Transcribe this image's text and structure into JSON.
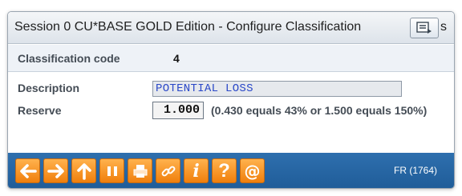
{
  "window": {
    "title": "Session 0 CU*BASE GOLD Edition - Configure Classification",
    "title_overflow": "s"
  },
  "header": {
    "classification_label": "Classification code",
    "classification_value": "4"
  },
  "form": {
    "description_label": "Description",
    "description_value": "POTENTIAL LOSS",
    "reserve_label": "Reserve",
    "reserve_value": "1.000",
    "reserve_hint": "(0.430 equals 43% or 1.500 equals 150%)"
  },
  "toolbar": {
    "buttons": [
      {
        "icon": "back-arrow-icon"
      },
      {
        "icon": "forward-arrow-icon"
      },
      {
        "icon": "up-arrow-icon"
      },
      {
        "icon": "pause-icon"
      },
      {
        "icon": "print-icon"
      },
      {
        "icon": "link-icon"
      },
      {
        "icon": "info-icon",
        "glyph": "i"
      },
      {
        "icon": "help-icon",
        "glyph": "?"
      },
      {
        "icon": "email-icon",
        "glyph": "@"
      }
    ],
    "status_code": "FR (1764)"
  },
  "colors": {
    "toolbar_blue": "#1f5c98",
    "button_orange": "#f07f0c",
    "field_text_blue": "#2a48c8"
  }
}
